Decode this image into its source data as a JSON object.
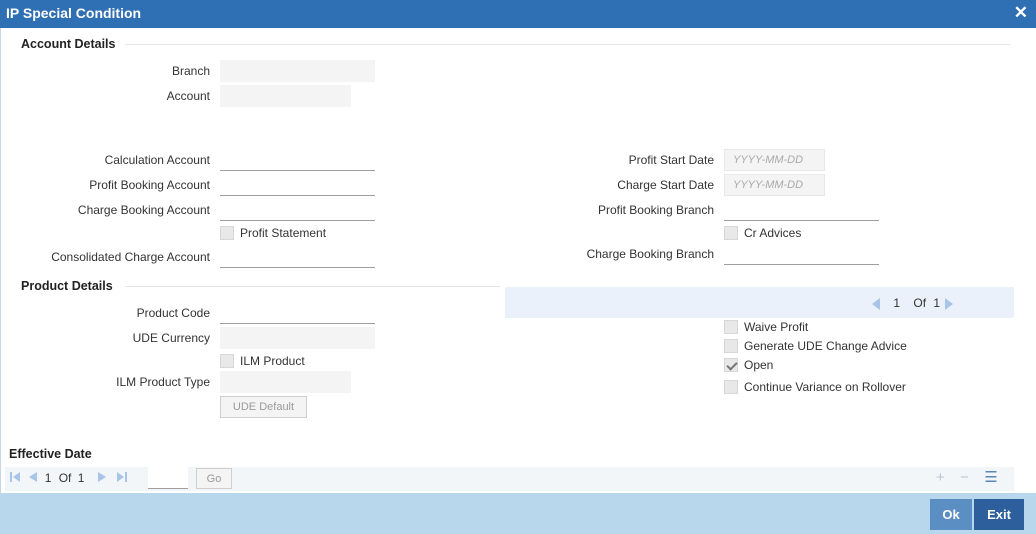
{
  "window": {
    "title": "IP Special Condition"
  },
  "account_details": {
    "section_title": "Account Details",
    "branch_label": "Branch",
    "account_label": "Account"
  },
  "left_fields": {
    "calculation_account": "Calculation Account",
    "profit_booking_account": "Profit Booking Account",
    "charge_booking_account": "Charge Booking Account",
    "profit_statement": "Profit Statement",
    "consolidated_charge_account": "Consolidated Charge Account"
  },
  "right_fields": {
    "profit_start_date": "Profit Start Date",
    "profit_start_placeholder": "YYYY-MM-DD",
    "charge_start_date": "Charge Start Date",
    "charge_start_placeholder": "YYYY-MM-DD",
    "profit_booking_branch": "Profit Booking Branch",
    "cr_advices": "Cr Advices",
    "charge_booking_branch": "Charge Booking Branch"
  },
  "product_details": {
    "section_title": "Product Details",
    "product_code": "Product Code",
    "ude_currency": "UDE Currency",
    "ilm_product": "ILM Product",
    "ilm_product_type": "ILM Product Type",
    "ude_default_button": "UDE Default"
  },
  "product_pager": {
    "current": "1",
    "of": "Of",
    "total": "1"
  },
  "options": {
    "waive_profit": "Waive Profit",
    "generate_ude_change_advice": "Generate UDE Change Advice",
    "open": "Open",
    "open_checked": true,
    "continue_variance": "Continue Variance on Rollover"
  },
  "effective_date": {
    "section_title": "Effective Date",
    "pager": {
      "current": "1",
      "of": "Of",
      "total": "1"
    },
    "go_button": "Go"
  },
  "icons": {
    "add": "+",
    "remove": "−",
    "list": "☰"
  },
  "footer": {
    "ok_button": "Ok",
    "exit_button": "Exit"
  }
}
